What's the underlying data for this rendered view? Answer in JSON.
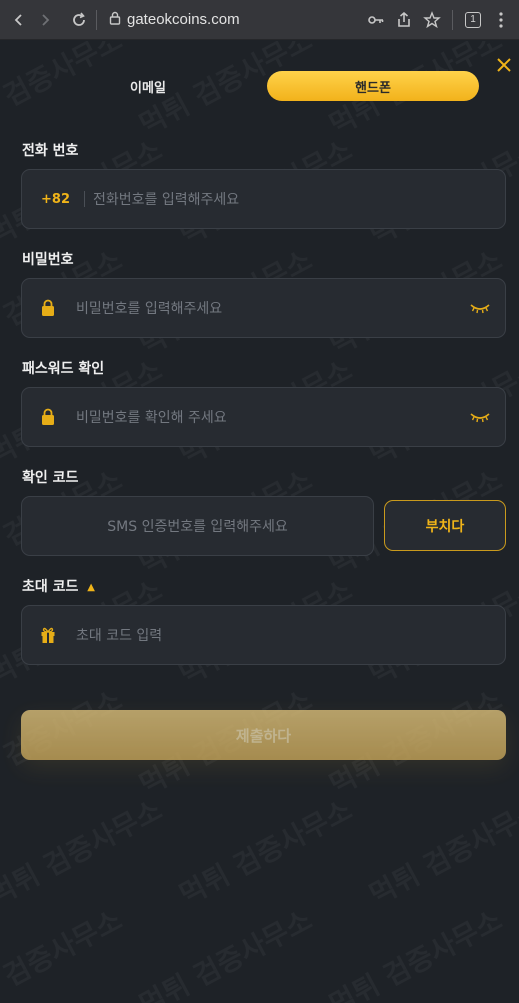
{
  "browser": {
    "url": "gateokcoins.com",
    "tab_count": "1"
  },
  "tabs": {
    "email": "이메일",
    "phone": "핸드폰"
  },
  "phone": {
    "label": "전화 번호",
    "prefix": "+82",
    "placeholder": "전화번호를 입력해주세요"
  },
  "password": {
    "label": "비밀번호",
    "placeholder": "비밀번호를 입력해주세요"
  },
  "password_confirm": {
    "label": "패스워드 확인",
    "placeholder": "비밀번호를 확인해 주세요"
  },
  "verification": {
    "label": "확인 코드",
    "placeholder": "SMS 인증번호를 입력해주세요",
    "send_label": "부치다"
  },
  "invite": {
    "label": "초대 코드",
    "arrow": "▲",
    "placeholder": "초대 코드 입력"
  },
  "submit": {
    "label": "제출하다"
  },
  "watermark": {
    "text": "먹튀 검증사무소"
  },
  "colors": {
    "accent": "#f0b419",
    "background": "#1e2227",
    "field": "#272b31"
  },
  "icons": [
    "back-icon",
    "forward-icon",
    "reload-icon",
    "site-info-icon",
    "key-icon",
    "share-icon",
    "bookmark-icon",
    "tabs-icon",
    "menu-icon",
    "close-icon",
    "lock-icon",
    "eye-closed-icon",
    "gift-icon"
  ]
}
